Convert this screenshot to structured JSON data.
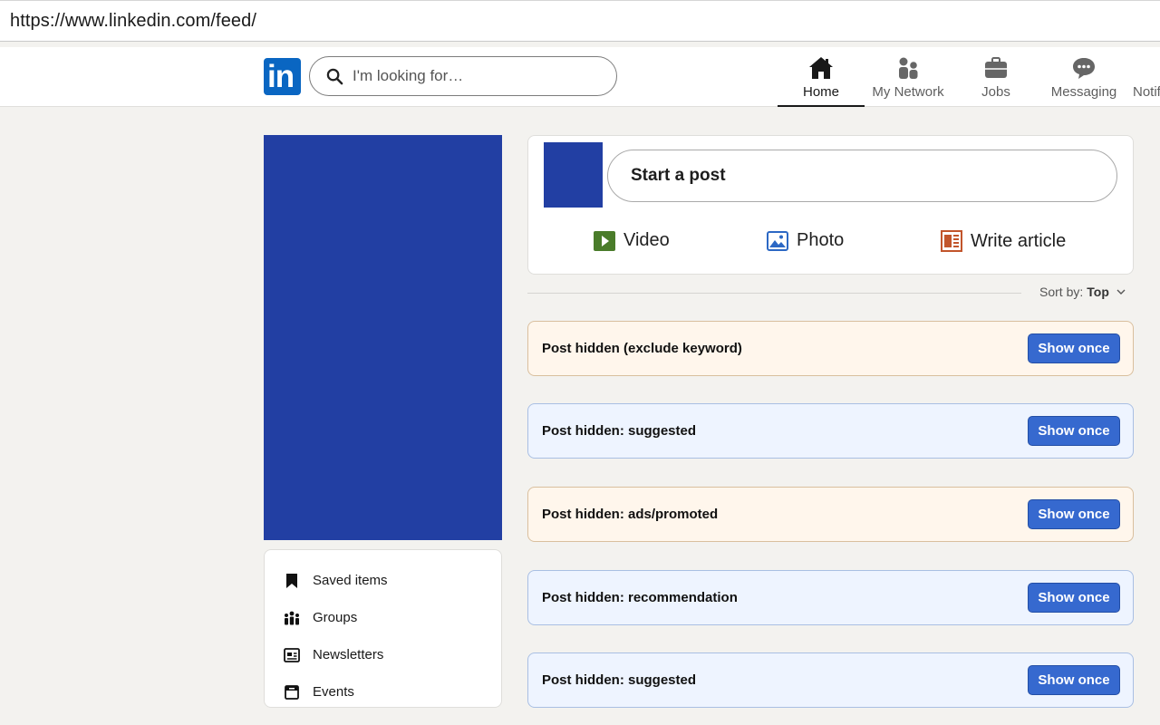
{
  "browser": {
    "url": "https://www.linkedin.com/feed/"
  },
  "nav": {
    "logo_text": "in",
    "search_placeholder": "I'm looking for…",
    "items": [
      {
        "label": "Home",
        "icon": "home-icon",
        "active": true
      },
      {
        "label": "My Network",
        "icon": "network-icon",
        "active": false
      },
      {
        "label": "Jobs",
        "icon": "briefcase-icon",
        "active": false
      },
      {
        "label": "Messaging",
        "icon": "chat-icon",
        "active": false
      },
      {
        "label": "Notifi",
        "icon": "bell-icon",
        "active": false
      }
    ]
  },
  "left_links": [
    {
      "label": "Saved items",
      "icon": "bookmark-icon"
    },
    {
      "label": "Groups",
      "icon": "groups-icon"
    },
    {
      "label": "Newsletters",
      "icon": "newsletter-icon"
    },
    {
      "label": "Events",
      "icon": "calendar-icon"
    }
  ],
  "share": {
    "start_post": "Start a post",
    "actions": [
      {
        "label": "Video",
        "icon": "video-icon",
        "color": "#4a7c2a"
      },
      {
        "label": "Photo",
        "icon": "photo-icon",
        "color": "#2c68c4"
      },
      {
        "label": "Write article",
        "icon": "article-icon",
        "color": "#c2552b"
      }
    ]
  },
  "sort": {
    "prefix": "Sort by:",
    "value": "Top"
  },
  "hidden_posts": [
    {
      "text": "Post hidden (exclude keyword)",
      "button": "Show once",
      "tone": "warm"
    },
    {
      "text": "Post hidden: suggested",
      "button": "Show once",
      "tone": "cool"
    },
    {
      "text": "Post hidden: ads/promoted",
      "button": "Show once",
      "tone": "warm"
    },
    {
      "text": "Post hidden: recommendation",
      "button": "Show once",
      "tone": "cool"
    },
    {
      "text": "Post hidden: suggested",
      "button": "Show once",
      "tone": "cool"
    }
  ],
  "colors": {
    "brand": "#0a66c2",
    "avatar_placeholder": "#223fa3",
    "button": "#3669cf"
  }
}
